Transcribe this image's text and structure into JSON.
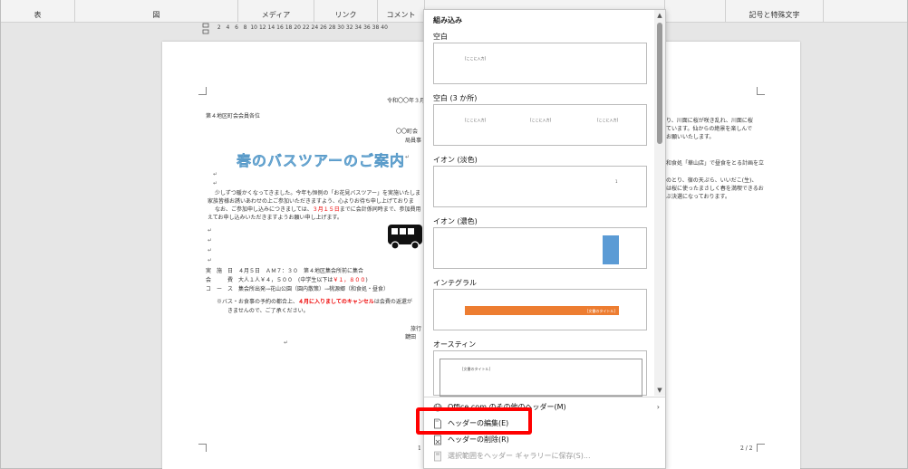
{
  "ribbon": {
    "groups": [
      {
        "label": "表"
      },
      {
        "label": "図"
      },
      {
        "label": "メディア"
      },
      {
        "label": "リンク"
      },
      {
        "label": "コメント"
      },
      {
        "label": "記号と特殊文字"
      }
    ]
  },
  "ruler": {
    "numbers": [
      "2",
      "4",
      "6",
      "8",
      "10",
      "12",
      "14",
      "16",
      "18",
      "20",
      "22",
      "24",
      "26",
      "28",
      "30",
      "32",
      "34",
      "36",
      "38",
      "40"
    ]
  },
  "document": {
    "date": "令和〇〇年３月",
    "to": "第４地区町会会員各位",
    "from1": "〇〇町会",
    "from2": "局員事",
    "title": "春のバスツアーのご案内",
    "para1": "少しずつ暖かくなってきました。今年も恒例の「お花見バスツアー」を実施いたしま",
    "para2": "家族皆様お誘いあわせの上ご参加いただきますよう、心よりお待ち申し上げておりま",
    "para3a": "なお、ご参加申し込みにつきましては、",
    "para3b": "３月１５日",
    "para3c": "までに会計係同時まで、参加費用",
    "para4": "えてお申し込みいただきますようお願い申し上げます。",
    "row1": "実　施　日　４月５日　ＡＭ７：３０　第４地区集会所前に集合",
    "row2a": "会　　　費　大人１人￥４，５００　(中学生以下は",
    "row2b": "￥１，８００",
    "row2c": ")",
    "row3": "コ　ー　ス　集会所出発→花山公園（園内散策）→桃源郷（和食処・昼食）",
    "note1a": "※バス・お食事の予約の都合上、",
    "note1b": "４月に入りましてのキャンセル",
    "note1c": "は会費の返還が",
    "note2": "きませんので、ご了承ください。",
    "contact1": "旅行",
    "contact2": "鍵田",
    "right1": "り、川面に桜が咲き乱れ、川面に桜",
    "right2": "ています。仙からの絶景を楽しんで",
    "right3": "お願いいたします。",
    "right4": "和食処「華山店」で昼食をとる計画を立",
    "right5": "のとり、宿の天ぷら、いいだこ(生)、",
    "right6": "は桜に使ったまさしく春を満喫できるお",
    "right7": "ぶ決選になっております。",
    "page_left": "1",
    "page_right": "2 / 2"
  },
  "panel": {
    "section_title": "組み込み",
    "items": [
      {
        "label": "空白",
        "placeholders": [
          "[ここに入力]"
        ]
      },
      {
        "label": "空白 (3 か所)",
        "placeholders": [
          "[ここに入力]",
          "[ここに入力]",
          "[ここに入力]"
        ]
      },
      {
        "label": "イオン (淡色)",
        "placeholders": [
          "1"
        ]
      },
      {
        "label": "イオン (濃色)",
        "placeholders": []
      },
      {
        "label": "インテグラル",
        "placeholders": [
          "[文書のタイトル]"
        ]
      },
      {
        "label": "オースティン",
        "placeholders": [
          "[文書のタイトル]"
        ]
      }
    ],
    "menu": {
      "more_headers": "Office.com のその他のヘッダー(M)",
      "edit_header": "ヘッダーの編集(E)",
      "remove_header": "ヘッダーの削除(R)",
      "save_selection": "選択範囲をヘッダー ギャラリーに保存(S)..."
    }
  },
  "colors": {
    "highlight": "#ff0000",
    "integral_bar": "#ed7d31",
    "ion_dark_block": "#5b9bd5",
    "title_fill": "#8fc3e6"
  }
}
